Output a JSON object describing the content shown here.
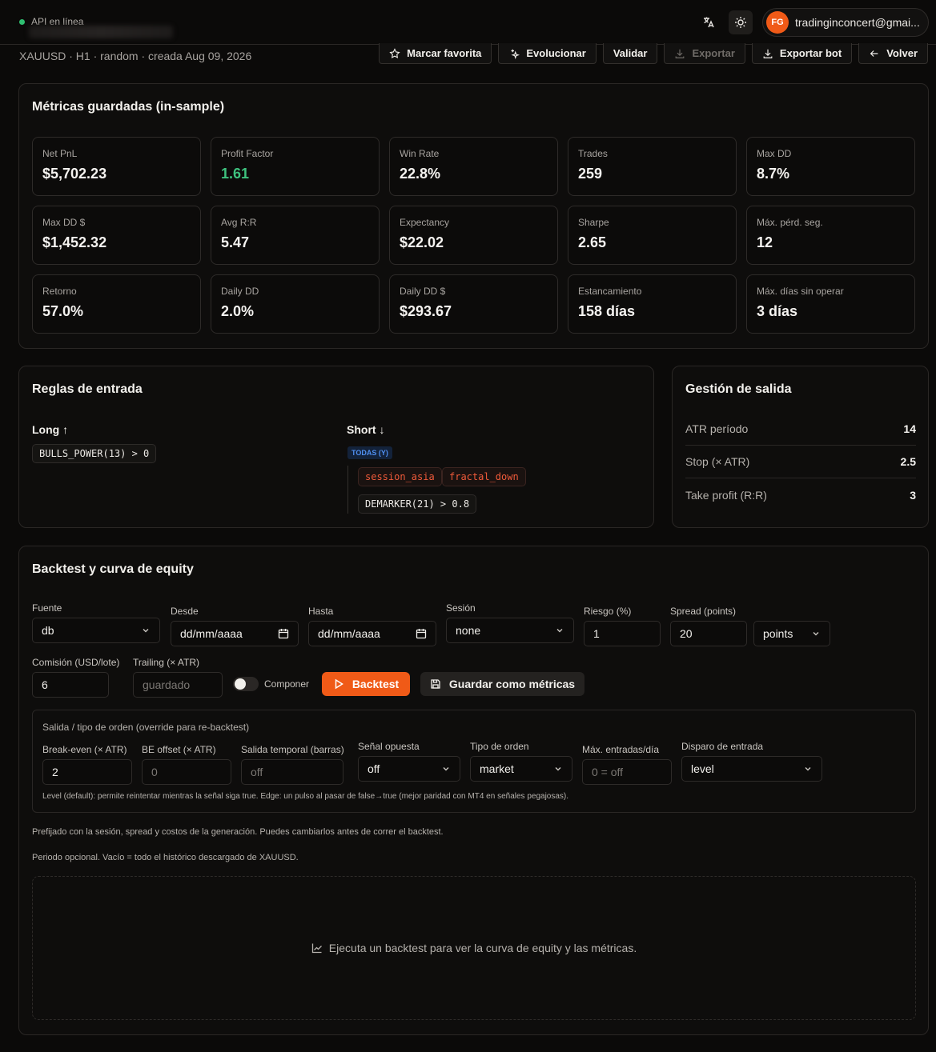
{
  "topbar": {
    "api_status": "API en línea",
    "user_initials": "FG",
    "user_email": "tradinginconcert@gmai..."
  },
  "header": {
    "subtitle": "XAUUSD · H1 · random · creada Aug 09, 2026",
    "actions": {
      "favorite": "Marcar favorita",
      "evolve": "Evolucionar",
      "validate": "Validar",
      "export": "Exportar",
      "export_bot": "Exportar bot",
      "back": "Volver"
    }
  },
  "metrics": {
    "title": "Métricas guardadas (in-sample)",
    "items": [
      {
        "label": "Net PnL",
        "value": "$5,702.23"
      },
      {
        "label": "Profit Factor",
        "value": "1.61"
      },
      {
        "label": "Win Rate",
        "value": "22.8%"
      },
      {
        "label": "Trades",
        "value": "259"
      },
      {
        "label": "Max DD",
        "value": "8.7%"
      },
      {
        "label": "Max DD $",
        "value": "$1,452.32"
      },
      {
        "label": "Avg R:R",
        "value": "5.47"
      },
      {
        "label": "Expectancy",
        "value": "$22.02"
      },
      {
        "label": "Sharpe",
        "value": "2.65"
      },
      {
        "label": "Máx. pérd. seg.",
        "value": "12"
      },
      {
        "label": "Retorno",
        "value": "57.0%"
      },
      {
        "label": "Daily DD",
        "value": "2.0%"
      },
      {
        "label": "Daily DD $",
        "value": "$293.67"
      },
      {
        "label": "Estancamiento",
        "value": "158 días"
      },
      {
        "label": "Máx. días sin operar",
        "value": "3 días"
      }
    ]
  },
  "entry_rules": {
    "title": "Reglas de entrada",
    "long_label": "Long",
    "long_rule": "BULLS_POWER(13) > 0",
    "short_label": "Short",
    "short_group": "TODAS (Y)",
    "short_tags": [
      "session_asia",
      "fractal_down"
    ],
    "short_rule": "DEMARKER(21) > 0.8"
  },
  "exit_mgmt": {
    "title": "Gestión de salida",
    "rows": [
      {
        "label": "ATR período",
        "value": "14"
      },
      {
        "label": "Stop (× ATR)",
        "value": "2.5"
      },
      {
        "label": "Take profit (R:R)",
        "value": "3"
      }
    ]
  },
  "backtest": {
    "title": "Backtest y curva de equity",
    "source_label": "Fuente",
    "source_value": "db",
    "from_label": "Desde",
    "from_value": "dd/mm/aaaa",
    "to_label": "Hasta",
    "to_value": "dd/mm/aaaa",
    "session_label": "Sesión",
    "session_value": "none",
    "risk_label": "Riesgo (%)",
    "risk_value": "1",
    "spread_label": "Spread (points)",
    "spread_value": "20",
    "spread_unit": "points",
    "commission_label": "Comisión (USD/lote)",
    "commission_value": "6",
    "trailing_label": "Trailing (× ATR)",
    "trailing_placeholder": "guardado",
    "compound_label": "Componer",
    "run_button": "Backtest",
    "save_button": "Guardar como métricas",
    "override": {
      "title": "Salida / tipo de orden (override para re-backtest)",
      "breakeven_label": "Break-even (× ATR)",
      "breakeven_value": "2",
      "be_offset_label": "BE offset (× ATR)",
      "be_offset_placeholder": "0",
      "time_exit_label": "Salida temporal (barras)",
      "time_exit_placeholder": "off",
      "opposite_label": "Señal opuesta",
      "opposite_value": "off",
      "order_type_label": "Tipo de orden",
      "order_type_value": "market",
      "max_entries_label": "Máx. entradas/día",
      "max_entries_placeholder": "0 = off",
      "trigger_label": "Disparo de entrada",
      "trigger_value": "level",
      "help": "Level (default): permite reintentar mientras la señal siga true. Edge: un pulso al pasar de false→true (mejor paridad con MT4 en señales pegajosas)."
    },
    "note1": "Prefijado con la sesión, spread y costos de la generación. Puedes cambiarlos antes de correr el backtest.",
    "note2": "Periodo opcional. Vacío = todo el histórico descargado de XAUUSD.",
    "empty_message": "Ejecuta un backtest para ver la curva de equity y las métricas."
  },
  "colors": {
    "accent": "#f05a17",
    "positive": "#3ec27e",
    "online": "#2fbf71",
    "badge": "#4f8ff0"
  }
}
